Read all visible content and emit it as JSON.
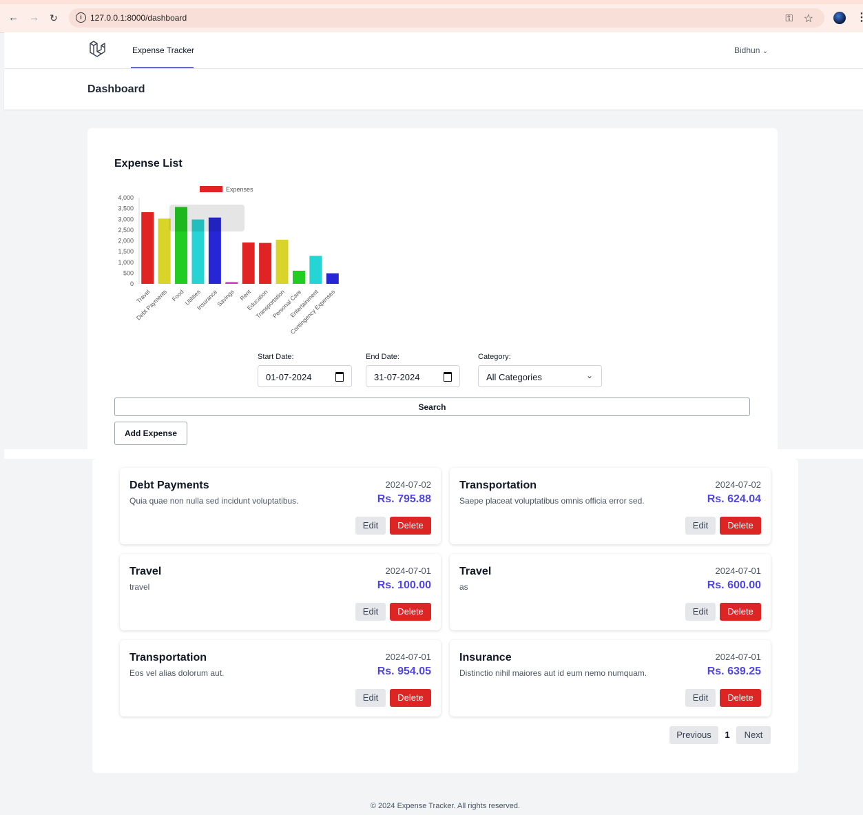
{
  "browser": {
    "url": "127.0.0.1:8000/dashboard"
  },
  "nav": {
    "brand_link": "Expense Tracker",
    "user_name": "Bidhun",
    "user_chevron": "⌄"
  },
  "header": {
    "title": "Dashboard"
  },
  "main": {
    "section_title": "Expense List",
    "filters": {
      "start_label": "Start Date:",
      "start_value": "01-07-2024",
      "end_label": "End Date:",
      "end_value": "31-07-2024",
      "category_label": "Category:",
      "category_value": "All Categories"
    },
    "search_label": "Search",
    "add_label": "Add Expense"
  },
  "chart_data": {
    "type": "bar",
    "legend": [
      "Expenses"
    ],
    "legend_placement": "top",
    "categories": [
      "Travel",
      "Debt Payments",
      "Food",
      "Utilities",
      "Insurance",
      "Savings",
      "Rent",
      "Education",
      "Transportation",
      "Personal Care",
      "Entertainment",
      "Contingency Expenses"
    ],
    "series": [
      {
        "name": "Expenses",
        "values": [
          3330,
          3030,
          3570,
          2990,
          3080,
          80,
          1920,
          1900,
          2050,
          610,
          1300,
          490
        ]
      }
    ],
    "colors": [
      "#e02424",
      "#d9d42a",
      "#22cc22",
      "#26d4d4",
      "#2626d4",
      "#cc33cc",
      "#e02424",
      "#e02424",
      "#d9d42a",
      "#22cc22",
      "#26d4d4",
      "#2626d4"
    ],
    "yticks": [
      "0",
      "500",
      "1,000",
      "1,500",
      "2,000",
      "2,500",
      "3,000",
      "3,500",
      "4,000"
    ],
    "ylim": [
      0,
      4000
    ],
    "grid": false
  },
  "expenses": [
    {
      "category": "Debt Payments",
      "description": "Quia quae non nulla sed incidunt voluptatibus.",
      "date": "2024-07-02",
      "amount": "Rs. 795.88"
    },
    {
      "category": "Transportation",
      "description": "Saepe placeat voluptatibus omnis officia error sed.",
      "date": "2024-07-02",
      "amount": "Rs. 624.04"
    },
    {
      "category": "Travel",
      "description": "travel",
      "date": "2024-07-01",
      "amount": "Rs. 100.00"
    },
    {
      "category": "Travel",
      "description": "as",
      "date": "2024-07-01",
      "amount": "Rs. 600.00"
    },
    {
      "category": "Transportation",
      "description": "Eos vel alias dolorum aut.",
      "date": "2024-07-01",
      "amount": "Rs. 954.05"
    },
    {
      "category": "Insurance",
      "description": "Distinctio nihil maiores aut id eum nemo numquam.",
      "date": "2024-07-01",
      "amount": "Rs. 639.25"
    }
  ],
  "actions": {
    "edit_label": "Edit",
    "delete_label": "Delete"
  },
  "pagination": {
    "previous": "Previous",
    "current": "1",
    "next": "Next"
  },
  "footer": {
    "text": "© 2024 Expense Tracker. All rights reserved."
  }
}
